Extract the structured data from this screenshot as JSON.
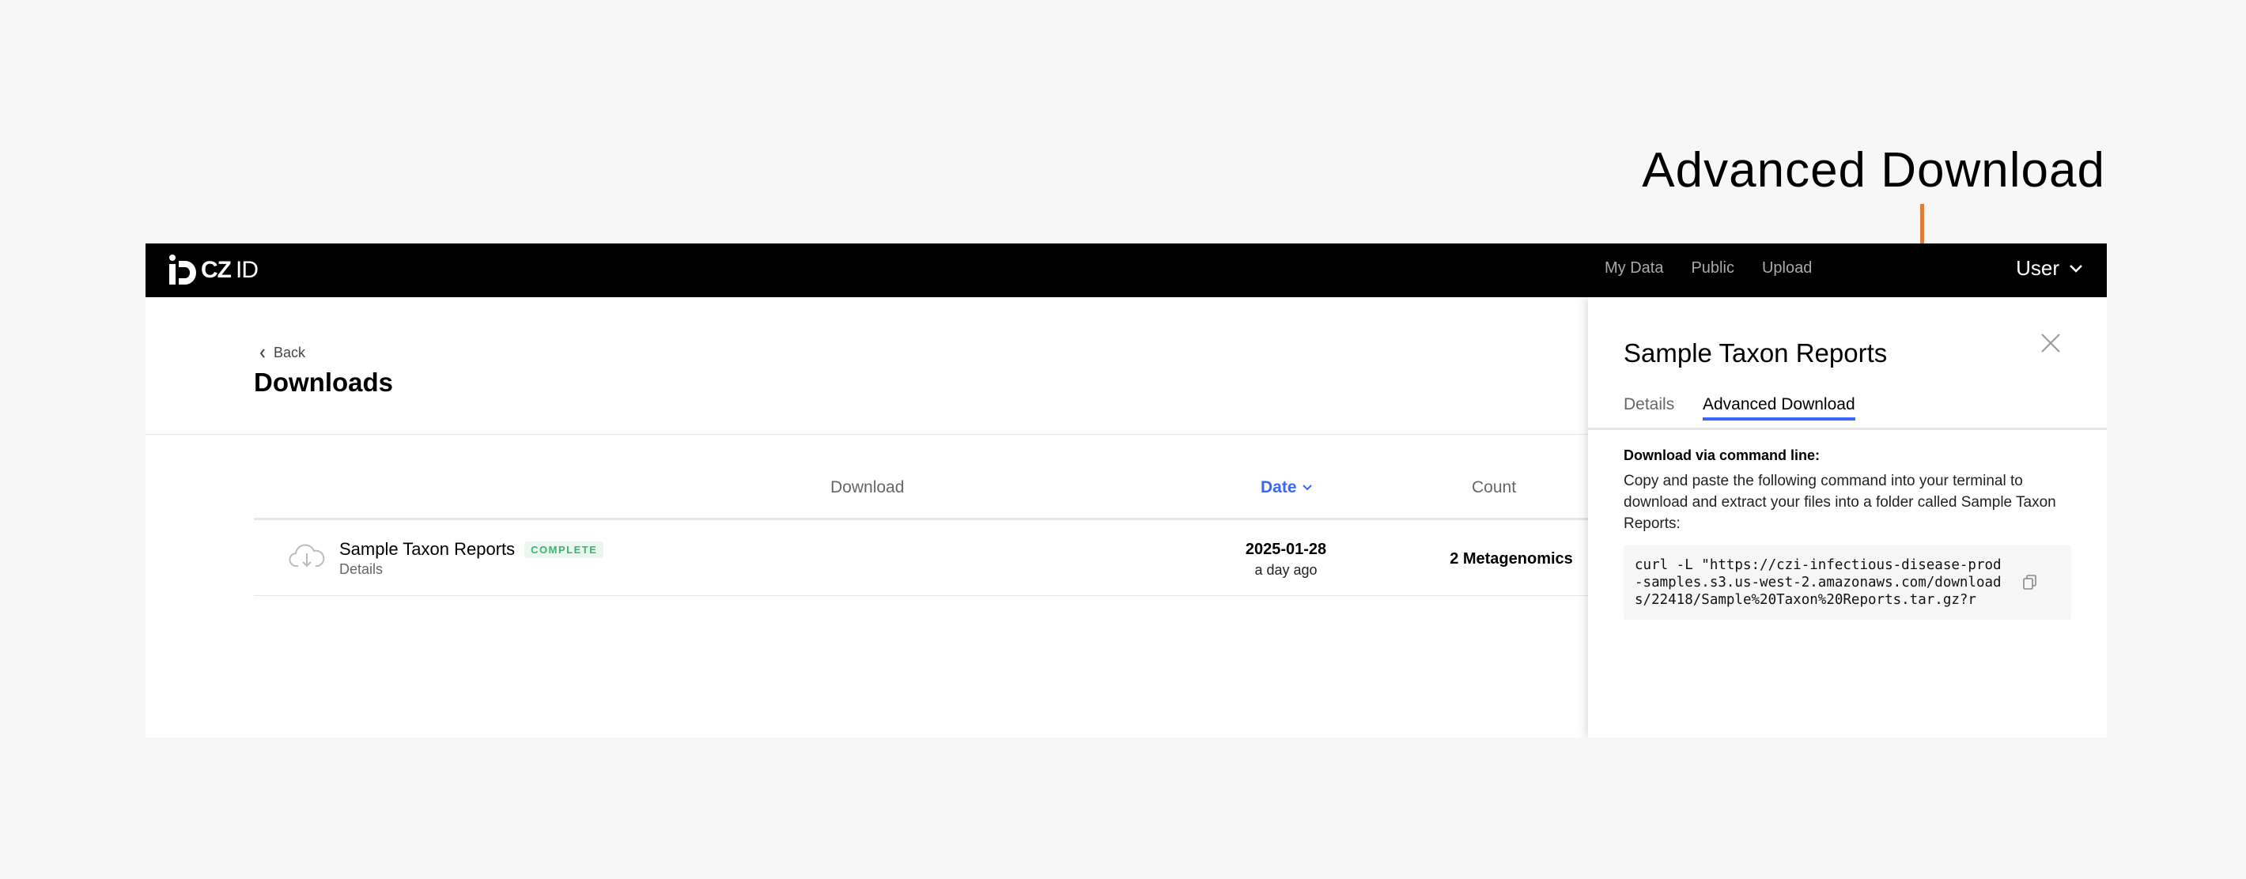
{
  "callout": {
    "label": "Advanced Download",
    "accent_color": "#e07e35"
  },
  "topnav": {
    "logo_text": "CZ",
    "logo_suffix": "ID",
    "links": [
      "My Data",
      "Public",
      "Upload"
    ],
    "user_label": "User"
  },
  "header": {
    "back_label": "Back",
    "title": "Downloads"
  },
  "table": {
    "columns": {
      "download": "Download",
      "date": "Date",
      "count": "Count"
    },
    "rows": [
      {
        "name": "Sample Taxon Reports",
        "status": "COMPLETE",
        "sub": "Details",
        "date": "2025-01-28",
        "relative": "a day ago",
        "count": "2 Metagenomics"
      }
    ]
  },
  "panel": {
    "title": "Sample Taxon Reports",
    "tabs": [
      "Details",
      "Advanced Download"
    ],
    "heading": "Download via command line:",
    "instructions": "Copy and paste the following command into your terminal to download and extract your files into a folder called Sample Taxon Reports:",
    "command": "curl -L \"https://czi-infectious-disease-prod-samples.s3.us-west-2.amazonaws.com/downloads/22418/Sample%20Taxon%20Reports.tar.gz?r"
  },
  "colors": {
    "accent_blue": "#3867fa",
    "status_green": "#3cb371",
    "nav_bg": "#000000"
  }
}
